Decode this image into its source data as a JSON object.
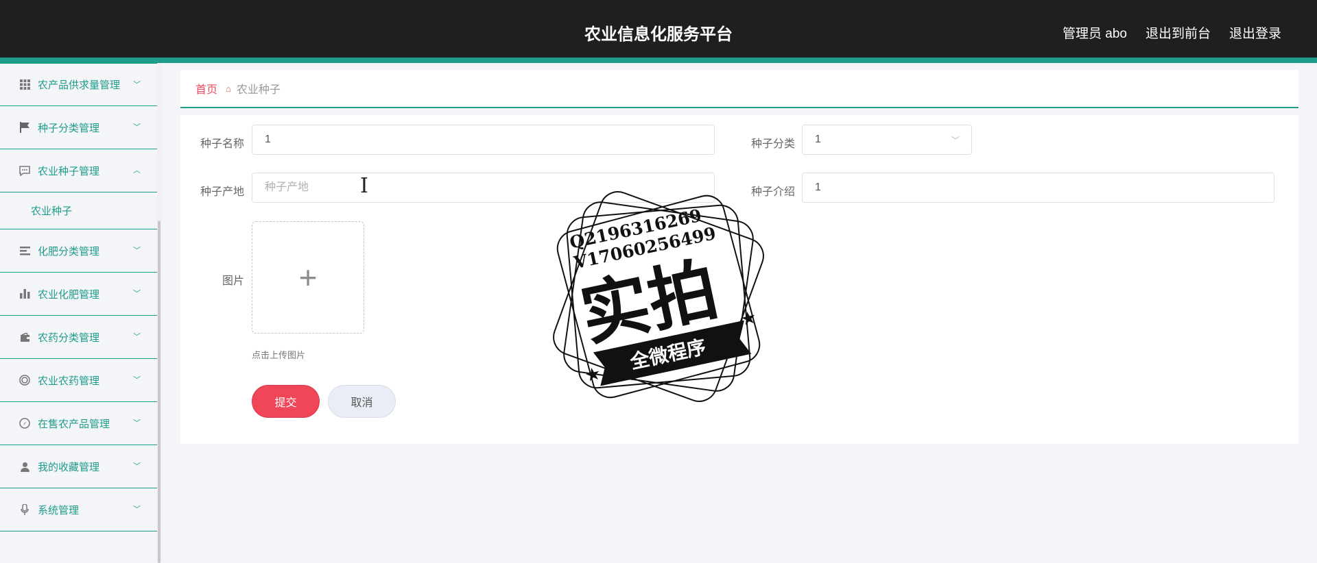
{
  "header": {
    "title": "农业信息化服务平台",
    "user": "管理员 abo",
    "exit_front": "退出到前台",
    "logout": "退出登录"
  },
  "sidebar": {
    "items": [
      {
        "label": "农产品供求量管理",
        "icon": "grid-icon"
      },
      {
        "label": "种子分类管理",
        "icon": "flag-icon"
      },
      {
        "label": "农业种子管理",
        "icon": "chat-icon",
        "expanded": true,
        "sub": "农业种子"
      },
      {
        "label": "化肥分类管理",
        "icon": "list-icon"
      },
      {
        "label": "农业化肥管理",
        "icon": "bar-chart-icon"
      },
      {
        "label": "农药分类管理",
        "icon": "wallet-icon"
      },
      {
        "label": "农业农药管理",
        "icon": "ring-icon"
      },
      {
        "label": "在售农产品管理",
        "icon": "compass-icon"
      },
      {
        "label": "我的收藏管理",
        "icon": "user-icon"
      },
      {
        "label": "系统管理",
        "icon": "mic-icon"
      }
    ]
  },
  "breadcrumb": {
    "home": "首页",
    "current": "农业种子"
  },
  "form": {
    "name_label": "种子名称",
    "name_value": "1",
    "category_label": "种子分类",
    "category_value": "1",
    "origin_label": "种子产地",
    "origin_placeholder": "种子产地",
    "intro_label": "种子介绍",
    "intro_value": "1",
    "image_label": "图片",
    "upload_hint": "点击上传图片",
    "submit": "提交",
    "cancel": "取消"
  },
  "watermark": {
    "line1": "Q2196316269",
    "line2": "V17060256499",
    "big": "实拍",
    "banner": "全微程序"
  },
  "colors": {
    "accent": "#1e9c8a",
    "header_bg": "#1f1f1f",
    "submit": "#f04658",
    "breadcrumb_home": "#e94a5e"
  }
}
